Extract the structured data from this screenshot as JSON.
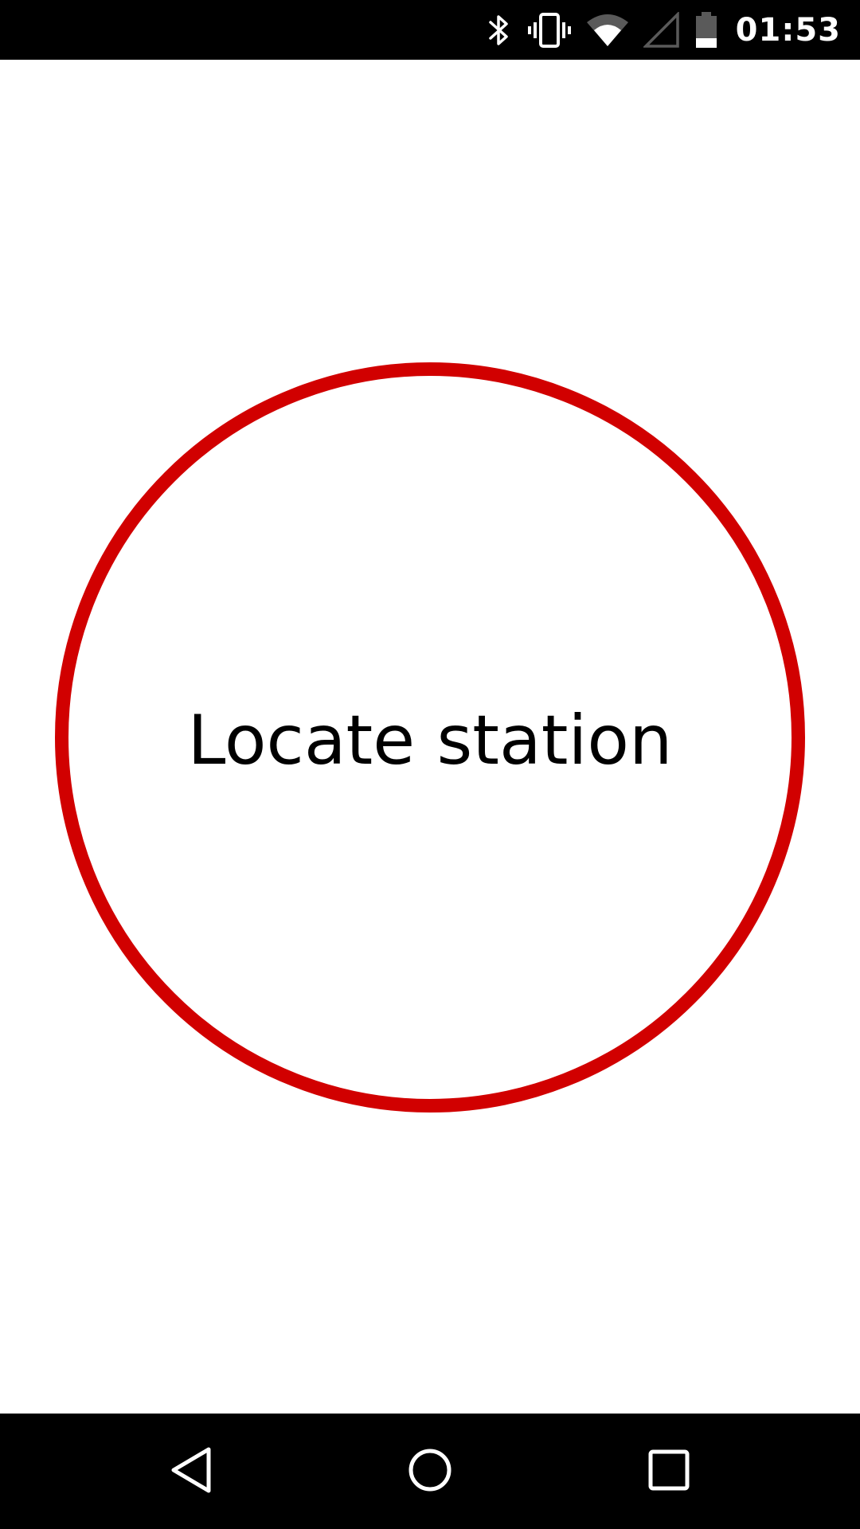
{
  "status_bar": {
    "time": "01:53",
    "icons": [
      "bluetooth-icon",
      "vibrate-icon",
      "wifi-icon",
      "signal-icon",
      "battery-icon"
    ]
  },
  "main": {
    "locate_button_label": "Locate station",
    "accent_color": "#d10000"
  },
  "nav_bar": {
    "buttons": [
      "back-icon",
      "home-icon",
      "recents-icon"
    ]
  }
}
